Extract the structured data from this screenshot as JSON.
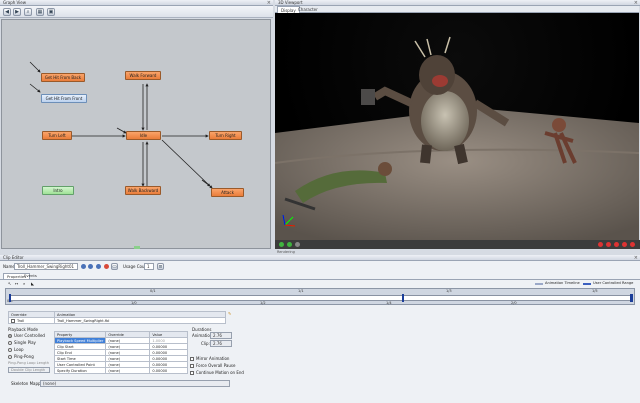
{
  "graph_view": {
    "title": "Graph View",
    "nodes": {
      "get_hit_back": "Get Hit From Back",
      "get_hit_front": "Get Hit From Front",
      "walk_forward": "Walk Forward",
      "turn_left": "Turn Left",
      "idle": "Idle",
      "turn_right": "Turn Right",
      "intro": "Intro",
      "walk_backward": "Walk Backward",
      "attack": "Attack"
    }
  },
  "viewport": {
    "title": "3D Viewport",
    "tabs": [
      "Display",
      "Character"
    ],
    "status_text": "Rendering"
  },
  "clip_editor": {
    "title": "Clip Editor",
    "name_label": "Name:",
    "name_value": "Troll_Hammer_SwingRight01",
    "usage_label": "Usage Count:",
    "usage_value": "1",
    "tabs": [
      "Properties",
      "Events"
    ],
    "legend_animation": "Animation Timeline",
    "legend_user": "User Controlled Range",
    "ticks": [
      "0/0",
      "0/1",
      "1/0",
      "1/1",
      "1/2",
      "1/3",
      "1/4",
      "1/5",
      "2/0"
    ],
    "overrides": {
      "col_override": "Override",
      "col_animation": "Animation",
      "row_override": "Troll",
      "row_animation": "Troll_Hammer_SwingRight.fbl"
    },
    "playback": {
      "title": "Playback Mode",
      "options": [
        "User Controlled",
        "Single Play",
        "Loop",
        "Ping-Pong"
      ],
      "selected": "User Controlled",
      "pp_label": "Ping-Pong Loop Length",
      "pp_value": "Double Clip Length"
    },
    "properties": {
      "headers": [
        "Property",
        "Override",
        "Value"
      ],
      "rows": [
        {
          "property": "Playback Speed Multiplier",
          "override": "(none)",
          "value": "1.0000"
        },
        {
          "property": "Clip Start",
          "override": "(none)",
          "value": "0.00000"
        },
        {
          "property": "Clip End",
          "override": "(none)",
          "value": "0.00000"
        },
        {
          "property": "Start Time",
          "override": "(none)",
          "value": "0.00000"
        },
        {
          "property": "User Controlled Point",
          "override": "(none)",
          "value": "0.00000"
        },
        {
          "property": "Specify Duration",
          "override": "(none)",
          "value": "0.00000"
        }
      ]
    },
    "durations": {
      "title": "Durations",
      "animation_label": "Animation:",
      "animation_value": "2.76",
      "clip_label": "Clip:",
      "clip_value": "2.76"
    },
    "checkboxes": [
      "Mirror Animation",
      "Force Overall Pause",
      "Continue Motion on End"
    ],
    "skeleton_label": "Skeleton Mapping:",
    "skeleton_value": "(none)"
  }
}
